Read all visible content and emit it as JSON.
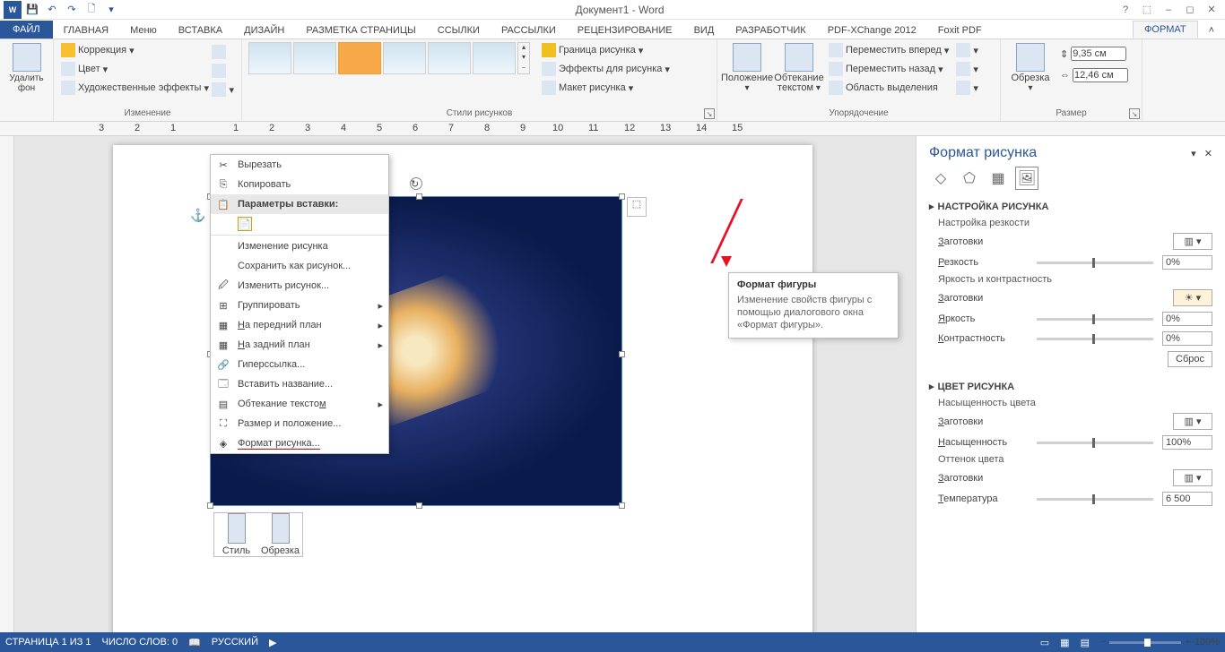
{
  "title": "Документ1 - Word",
  "qat": {
    "save": "💾",
    "undo": "↶",
    "redo": "↷",
    "new": "🗋"
  },
  "win": {
    "help": "?",
    "opts": "⬚",
    "min": "–",
    "max": "◻",
    "close": "✕"
  },
  "tabs": {
    "file": "ФАЙЛ",
    "home": "ГЛАВНАЯ",
    "menu": "Меню",
    "insert": "ВСТАВКА",
    "design": "ДИЗАЙН",
    "layout": "РАЗМЕТКА СТРАНИЦЫ",
    "refs": "ССЫЛКИ",
    "mail": "РАССЫЛКИ",
    "review": "РЕЦЕНЗИРОВАНИЕ",
    "view": "ВИД",
    "dev": "РАЗРАБОТЧИК",
    "pdfx": "PDF-XChange 2012",
    "foxit": "Foxit PDF",
    "format": "ФОРМАТ"
  },
  "ribbon": {
    "remove_bg": {
      "label": "Удалить фон"
    },
    "adjust": {
      "corrections": "Коррекция",
      "color": "Цвет",
      "effects": "Художественные эффекты",
      "label": "Изменение"
    },
    "styles": {
      "label": "Стили рисунков",
      "border": "Граница рисунка",
      "fx": "Эффекты для рисунка",
      "layout": "Макет рисунка"
    },
    "arrange": {
      "position": "Положение",
      "wrap": "Обтекание текстом",
      "fwd": "Переместить вперед",
      "back": "Переместить назад",
      "sel": "Область выделения",
      "label": "Упорядочение"
    },
    "size": {
      "crop": "Обрезка",
      "h": "9,35 см",
      "w": "12,46 см",
      "label": "Размер"
    }
  },
  "ruler": [
    "3",
    "2",
    "1",
    "",
    "1",
    "2",
    "3",
    "4",
    "5",
    "6",
    "7",
    "8",
    "9",
    "10",
    "11",
    "12",
    "13",
    "14",
    "15"
  ],
  "tooltip": {
    "title": "Формат фигуры",
    "body": "Изменение свойств фигуры с помощью диалогового окна «Формат фигуры»."
  },
  "ctx": {
    "cut": "Вырезать",
    "copy": "Копировать",
    "paste_opts": "Параметры вставки:",
    "change": "Изменение рисунка",
    "saveas": "Сохранить как рисунок...",
    "edit": "Изменить рисунок...",
    "group": "Группировать",
    "front": "На передний план",
    "back": "На задний план",
    "link": "Гиперссылка...",
    "caption": "Вставить название...",
    "wrap": "Обтекание текстом",
    "sizepos": "Размер и положение...",
    "format": "Формат рисунка..."
  },
  "mini": {
    "style": "Стиль",
    "crop": "Обрезка"
  },
  "pane": {
    "title": "Формат рисунка",
    "sec1": "НАСТРОЙКА РИСУНКА",
    "sharp_h": "Настройка резкости",
    "presets": "Заготовки",
    "sharp": "Резкость",
    "sharp_v": "0%",
    "bc_h": "Яркость и контрастность",
    "bright": "Яркость",
    "bright_v": "0%",
    "contrast": "Контрастность",
    "contrast_v": "0%",
    "reset": "Сброс",
    "sec2": "ЦВЕТ РИСУНКА",
    "sat_h": "Насыщенность цвета",
    "sat": "Насыщенность",
    "sat_v": "100%",
    "tone_h": "Оттенок цвета",
    "temp": "Температура",
    "temp_v": "6 500"
  },
  "status": {
    "page": "СТРАНИЦА 1 ИЗ 1",
    "words": "ЧИСЛО СЛОВ: 0",
    "lang": "РУССКИЙ",
    "zoom": "100%"
  }
}
